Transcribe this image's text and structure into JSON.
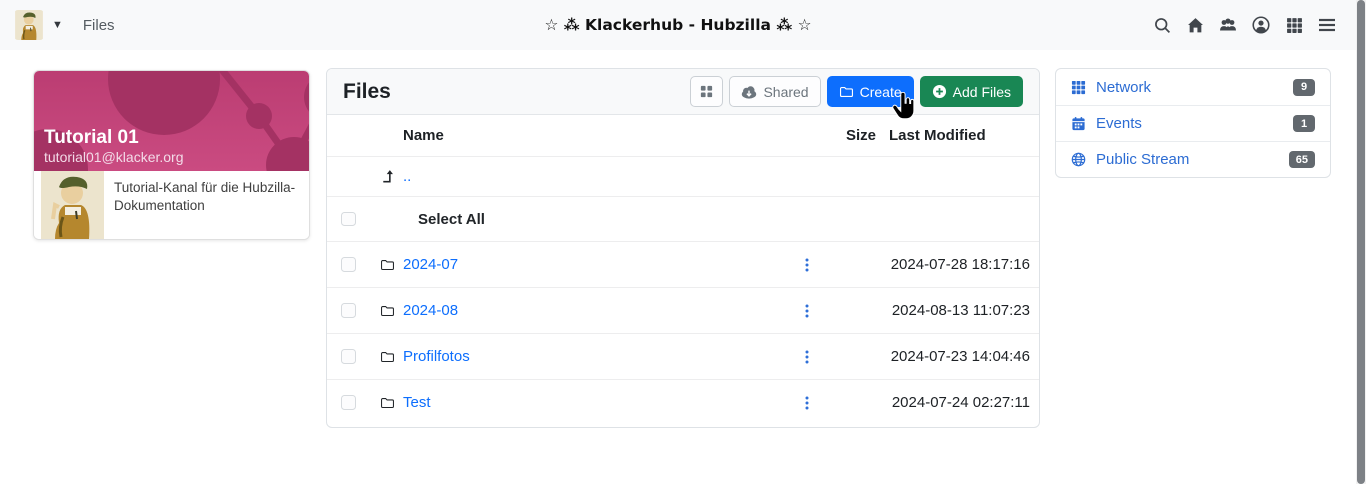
{
  "navbar": {
    "context_label": "Files",
    "site_title": "☆ ⁂ Klackerhub - Hubzilla ⁂ ☆"
  },
  "channel_card": {
    "name": "Tutorial 01",
    "address": "tutorial01@klacker.org",
    "description": "Tutorial-Kanal für die Hubzilla-Dokumentation"
  },
  "files": {
    "title": "Files",
    "shared_label": "Shared",
    "create_label": "Create",
    "add_files_label": "Add Files",
    "headers": {
      "name": "Name",
      "size": "Size",
      "modified": "Last Modified"
    },
    "parent_label": "..",
    "select_all_label": "Select All",
    "rows": [
      {
        "name": "2024-07",
        "size": "",
        "modified": "2024-07-28 18:17:16"
      },
      {
        "name": "2024-08",
        "size": "",
        "modified": "2024-08-13 11:07:23"
      },
      {
        "name": "Profilfotos",
        "size": "",
        "modified": "2024-07-23 14:04:46"
      },
      {
        "name": "Test",
        "size": "",
        "modified": "2024-07-24 02:27:11"
      }
    ]
  },
  "sidebar": {
    "items": [
      {
        "label": "Network",
        "badge": "9"
      },
      {
        "label": "Events",
        "badge": "1"
      },
      {
        "label": "Public Stream",
        "badge": "65"
      }
    ]
  },
  "colors": {
    "accent_blue": "#0d6efd",
    "success_green": "#198754",
    "banner_magenta": "#c2447b",
    "badge_gray": "#62686e",
    "navbar_bg": "#f8f9fa"
  }
}
